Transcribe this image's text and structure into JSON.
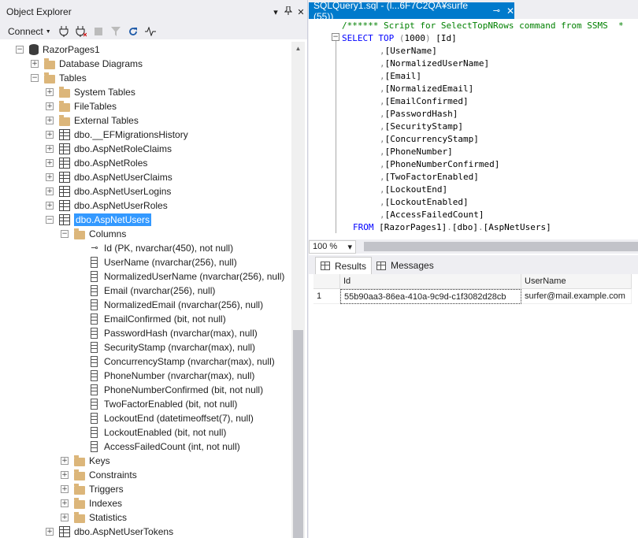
{
  "object_explorer": {
    "title": "Object Explorer",
    "controls": [
      "▾",
      "📌",
      "✕"
    ],
    "toolbar": {
      "connect_label": "Connect"
    },
    "tree": [
      {
        "label": "RazorPages1",
        "icon": "database-icon",
        "exp": "−",
        "level": 0
      },
      {
        "label": "Database Diagrams",
        "icon": "folder-icon",
        "exp": "+",
        "level": 1
      },
      {
        "label": "Tables",
        "icon": "folder-icon",
        "exp": "−",
        "level": 1
      },
      {
        "label": "System Tables",
        "icon": "folder-icon",
        "exp": "+",
        "level": 2
      },
      {
        "label": "FileTables",
        "icon": "folder-icon",
        "exp": "+",
        "level": 2
      },
      {
        "label": "External Tables",
        "icon": "folder-icon",
        "exp": "+",
        "level": 2
      },
      {
        "label": "dbo.__EFMigrationsHistory",
        "icon": "table-icon",
        "exp": "+",
        "level": 2
      },
      {
        "label": "dbo.AspNetRoleClaims",
        "icon": "table-icon",
        "exp": "+",
        "level": 2
      },
      {
        "label": "dbo.AspNetRoles",
        "icon": "table-icon",
        "exp": "+",
        "level": 2
      },
      {
        "label": "dbo.AspNetUserClaims",
        "icon": "table-icon",
        "exp": "+",
        "level": 2
      },
      {
        "label": "dbo.AspNetUserLogins",
        "icon": "table-icon",
        "exp": "+",
        "level": 2
      },
      {
        "label": "dbo.AspNetUserRoles",
        "icon": "table-icon",
        "exp": "+",
        "level": 2
      },
      {
        "label": "dbo.AspNetUsers",
        "icon": "table-icon",
        "exp": "−",
        "level": 2,
        "selected": true
      },
      {
        "label": "Columns",
        "icon": "folder-icon",
        "exp": "−",
        "level": 3
      },
      {
        "label": "Id (PK, nvarchar(450), not null)",
        "icon": "key-icon",
        "exp": "",
        "level": 4
      },
      {
        "label": "UserName (nvarchar(256), null)",
        "icon": "column-icon",
        "exp": "",
        "level": 4
      },
      {
        "label": "NormalizedUserName (nvarchar(256), null)",
        "icon": "column-icon",
        "exp": "",
        "level": 4
      },
      {
        "label": "Email (nvarchar(256), null)",
        "icon": "column-icon",
        "exp": "",
        "level": 4
      },
      {
        "label": "NormalizedEmail (nvarchar(256), null)",
        "icon": "column-icon",
        "exp": "",
        "level": 4
      },
      {
        "label": "EmailConfirmed (bit, not null)",
        "icon": "column-icon",
        "exp": "",
        "level": 4
      },
      {
        "label": "PasswordHash (nvarchar(max), null)",
        "icon": "column-icon",
        "exp": "",
        "level": 4
      },
      {
        "label": "SecurityStamp (nvarchar(max), null)",
        "icon": "column-icon",
        "exp": "",
        "level": 4
      },
      {
        "label": "ConcurrencyStamp (nvarchar(max), null)",
        "icon": "column-icon",
        "exp": "",
        "level": 4
      },
      {
        "label": "PhoneNumber (nvarchar(max), null)",
        "icon": "column-icon",
        "exp": "",
        "level": 4
      },
      {
        "label": "PhoneNumberConfirmed (bit, not null)",
        "icon": "column-icon",
        "exp": "",
        "level": 4
      },
      {
        "label": "TwoFactorEnabled (bit, not null)",
        "icon": "column-icon",
        "exp": "",
        "level": 4
      },
      {
        "label": "LockoutEnd (datetimeoffset(7), null)",
        "icon": "column-icon",
        "exp": "",
        "level": 4
      },
      {
        "label": "LockoutEnabled (bit, not null)",
        "icon": "column-icon",
        "exp": "",
        "level": 4
      },
      {
        "label": "AccessFailedCount (int, not null)",
        "icon": "column-icon",
        "exp": "",
        "level": 4
      },
      {
        "label": "Keys",
        "icon": "folder-icon",
        "exp": "+",
        "level": 3
      },
      {
        "label": "Constraints",
        "icon": "folder-icon",
        "exp": "+",
        "level": 3
      },
      {
        "label": "Triggers",
        "icon": "folder-icon",
        "exp": "+",
        "level": 3
      },
      {
        "label": "Indexes",
        "icon": "folder-icon",
        "exp": "+",
        "level": 3
      },
      {
        "label": "Statistics",
        "icon": "folder-icon",
        "exp": "+",
        "level": 3
      },
      {
        "label": "dbo.AspNetUserTokens",
        "icon": "table-icon",
        "exp": "+",
        "level": 2
      }
    ]
  },
  "query_tab": {
    "title": "SQLQuery1.sql - (l...6F7C2QA¥surfe (55))",
    "pin": "⊸",
    "close": "✕"
  },
  "editor": {
    "collapse_glyph": "−",
    "lines": [
      {
        "parts": [
          {
            "c": "cm",
            "t": "/****** Script for SelectTopNRows command from SSMS  *"
          }
        ],
        "indent": 0
      },
      {
        "parts": [
          {
            "c": "kw",
            "t": "SELECT TOP "
          },
          {
            "c": "gy",
            "t": "("
          },
          {
            "c": "bk",
            "t": "1000"
          },
          {
            "c": "gy",
            "t": ") "
          },
          {
            "c": "bk",
            "t": "[Id]"
          }
        ],
        "indent": 0
      },
      {
        "parts": [
          {
            "c": "gy",
            "t": ","
          },
          {
            "c": "bk",
            "t": "[UserName]"
          }
        ],
        "indent": 1
      },
      {
        "parts": [
          {
            "c": "gy",
            "t": ","
          },
          {
            "c": "bk",
            "t": "[NormalizedUserName]"
          }
        ],
        "indent": 1
      },
      {
        "parts": [
          {
            "c": "gy",
            "t": ","
          },
          {
            "c": "bk",
            "t": "[Email]"
          }
        ],
        "indent": 1
      },
      {
        "parts": [
          {
            "c": "gy",
            "t": ","
          },
          {
            "c": "bk",
            "t": "[NormalizedEmail]"
          }
        ],
        "indent": 1
      },
      {
        "parts": [
          {
            "c": "gy",
            "t": ","
          },
          {
            "c": "bk",
            "t": "[EmailConfirmed]"
          }
        ],
        "indent": 1
      },
      {
        "parts": [
          {
            "c": "gy",
            "t": ","
          },
          {
            "c": "bk",
            "t": "[PasswordHash]"
          }
        ],
        "indent": 1
      },
      {
        "parts": [
          {
            "c": "gy",
            "t": ","
          },
          {
            "c": "bk",
            "t": "[SecurityStamp]"
          }
        ],
        "indent": 1
      },
      {
        "parts": [
          {
            "c": "gy",
            "t": ","
          },
          {
            "c": "bk",
            "t": "[ConcurrencyStamp]"
          }
        ],
        "indent": 1
      },
      {
        "parts": [
          {
            "c": "gy",
            "t": ","
          },
          {
            "c": "bk",
            "t": "[PhoneNumber]"
          }
        ],
        "indent": 1
      },
      {
        "parts": [
          {
            "c": "gy",
            "t": ","
          },
          {
            "c": "bk",
            "t": "[PhoneNumberConfirmed]"
          }
        ],
        "indent": 1
      },
      {
        "parts": [
          {
            "c": "gy",
            "t": ","
          },
          {
            "c": "bk",
            "t": "[TwoFactorEnabled]"
          }
        ],
        "indent": 1
      },
      {
        "parts": [
          {
            "c": "gy",
            "t": ","
          },
          {
            "c": "bk",
            "t": "[LockoutEnd]"
          }
        ],
        "indent": 1
      },
      {
        "parts": [
          {
            "c": "gy",
            "t": ","
          },
          {
            "c": "bk",
            "t": "[LockoutEnabled]"
          }
        ],
        "indent": 1
      },
      {
        "parts": [
          {
            "c": "gy",
            "t": ","
          },
          {
            "c": "bk",
            "t": "[AccessFailedCount]"
          }
        ],
        "indent": 1
      },
      {
        "parts": [
          {
            "c": "kw",
            "t": "FROM "
          },
          {
            "c": "bk",
            "t": "[RazorPages1]"
          },
          {
            "c": "gy",
            "t": "."
          },
          {
            "c": "bk",
            "t": "[dbo]"
          },
          {
            "c": "gy",
            "t": "."
          },
          {
            "c": "bk",
            "t": "[AspNetUsers]"
          }
        ],
        "indent": 2
      }
    ]
  },
  "zoom": {
    "value": "100 %",
    "caret": "▾"
  },
  "results": {
    "tabs": [
      {
        "label": "Results",
        "active": true
      },
      {
        "label": "Messages",
        "active": false
      }
    ],
    "columns": [
      "Id",
      "UserName"
    ],
    "rows": [
      {
        "num": "1",
        "cells": [
          "55b90aa3-86ea-410a-9c9d-c1f3082d28cb",
          "surfer@mail.example.com"
        ]
      }
    ]
  },
  "colors": {
    "accent": "#007acc",
    "selection": "#3399ff",
    "keyword": "#0000ff",
    "comment": "#008000"
  }
}
